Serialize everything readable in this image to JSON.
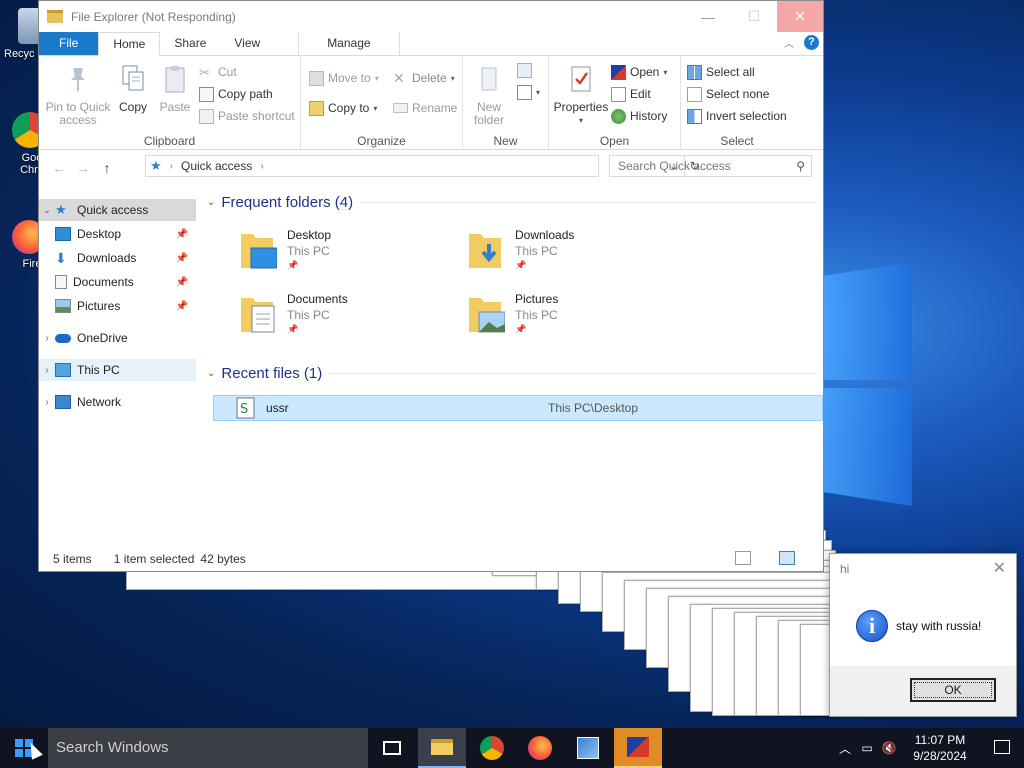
{
  "desktop": {
    "icons": [
      {
        "label": "Recyc",
        "icon": "recycle-bin-icon"
      },
      {
        "label": "Goo\nChro",
        "icon": "chrome-icon"
      },
      {
        "label": "Fire",
        "icon": "firefox-icon"
      }
    ]
  },
  "window": {
    "title": "File Explorer (Not Responding)",
    "controls": {
      "minimize": "—",
      "maximize": "☐",
      "close": "✕"
    }
  },
  "tabs": {
    "file": "File",
    "home": "Home",
    "share": "Share",
    "view": "View",
    "manage": "Manage"
  },
  "ribbon": {
    "clipboard": {
      "label": "Clipboard",
      "pin_quick_access": "Pin to Quick\naccess",
      "copy": "Copy",
      "paste": "Paste",
      "cut": "Cut",
      "copy_path": "Copy path",
      "paste_shortcut": "Paste shortcut"
    },
    "organize": {
      "label": "Organize",
      "move_to": "Move to",
      "copy_to": "Copy to",
      "delete": "Delete",
      "rename": "Rename"
    },
    "new": {
      "label": "New",
      "new_folder": "New\nfolder"
    },
    "open": {
      "label": "Open",
      "properties": "Properties",
      "open": "Open",
      "edit": "Edit",
      "history": "History"
    },
    "select": {
      "label": "Select",
      "select_all": "Select all",
      "select_none": "Select none",
      "invert_selection": "Invert selection"
    }
  },
  "address": {
    "path": "Quick access",
    "search_placeholder": "Search Quick access"
  },
  "nav": {
    "quick_access": "Quick access",
    "desktop": "Desktop",
    "downloads": "Downloads",
    "documents": "Documents",
    "pictures": "Pictures",
    "onedrive": "OneDrive",
    "this_pc": "This PC",
    "network": "Network"
  },
  "content": {
    "frequent_header": "Frequent folders (4)",
    "folders": [
      {
        "name": "Desktop",
        "location": "This PC"
      },
      {
        "name": "Downloads",
        "location": "This PC"
      },
      {
        "name": "Documents",
        "location": "This PC"
      },
      {
        "name": "Pictures",
        "location": "This PC"
      }
    ],
    "recent_header": "Recent files (1)",
    "recent": [
      {
        "name": "ussr",
        "path": "This PC\\Desktop"
      }
    ]
  },
  "status": {
    "items": "5 items",
    "selected": "1 item selected",
    "size": "42 bytes"
  },
  "msgbox": {
    "title": "hi",
    "text": "stay with russia!",
    "ok": "OK"
  },
  "taskbar": {
    "search_placeholder": "Search Windows",
    "time": "11:07 PM",
    "date": "9/28/2024"
  },
  "colors": {
    "accent": "#1979ca",
    "selection": "#cce8ff",
    "taskbar": "#101420",
    "flash": "#e08b26"
  }
}
